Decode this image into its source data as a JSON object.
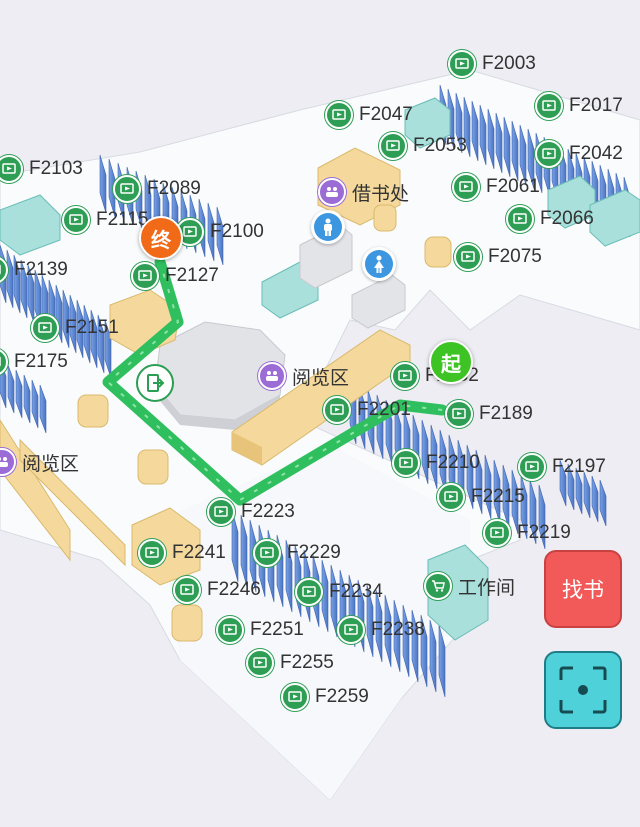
{
  "bookshelves": [
    {
      "code": "F2003"
    },
    {
      "code": "F2017"
    },
    {
      "code": "F2047"
    },
    {
      "code": "F2053"
    },
    {
      "code": "F2042"
    },
    {
      "code": "F2103"
    },
    {
      "code": "F2089"
    },
    {
      "code": "F2061"
    },
    {
      "code": "F2115"
    },
    {
      "code": "F2100"
    },
    {
      "code": "F2066"
    },
    {
      "code": "F2139"
    },
    {
      "code": "F2127"
    },
    {
      "code": "F2075"
    },
    {
      "code": "F2151"
    },
    {
      "code": "F2175"
    },
    {
      "code": "F2152"
    },
    {
      "code": "F2201"
    },
    {
      "code": "F2189"
    },
    {
      "code": "F2210"
    },
    {
      "code": "F2197"
    },
    {
      "code": "F2215"
    },
    {
      "code": "F2223"
    },
    {
      "code": "F2219"
    },
    {
      "code": "F2241"
    },
    {
      "code": "F2229"
    },
    {
      "code": "F2246"
    },
    {
      "code": "F2234"
    },
    {
      "code": "F2251"
    },
    {
      "code": "F2238"
    },
    {
      "code": "F2255"
    },
    {
      "code": "F2259"
    }
  ],
  "areas": {
    "borrow": "借书处",
    "reading": "阅览区",
    "workroom": "工作间"
  },
  "markers": {
    "start": "起",
    "end": "终"
  },
  "buttons": {
    "find_book": "找书"
  },
  "colors": {
    "route": "#2fbf5e",
    "shelf": "#5b86d4",
    "shelf_icon": "#2e9e55",
    "find_button": "#f25a5a",
    "scan_button": "#4fd1d9"
  }
}
